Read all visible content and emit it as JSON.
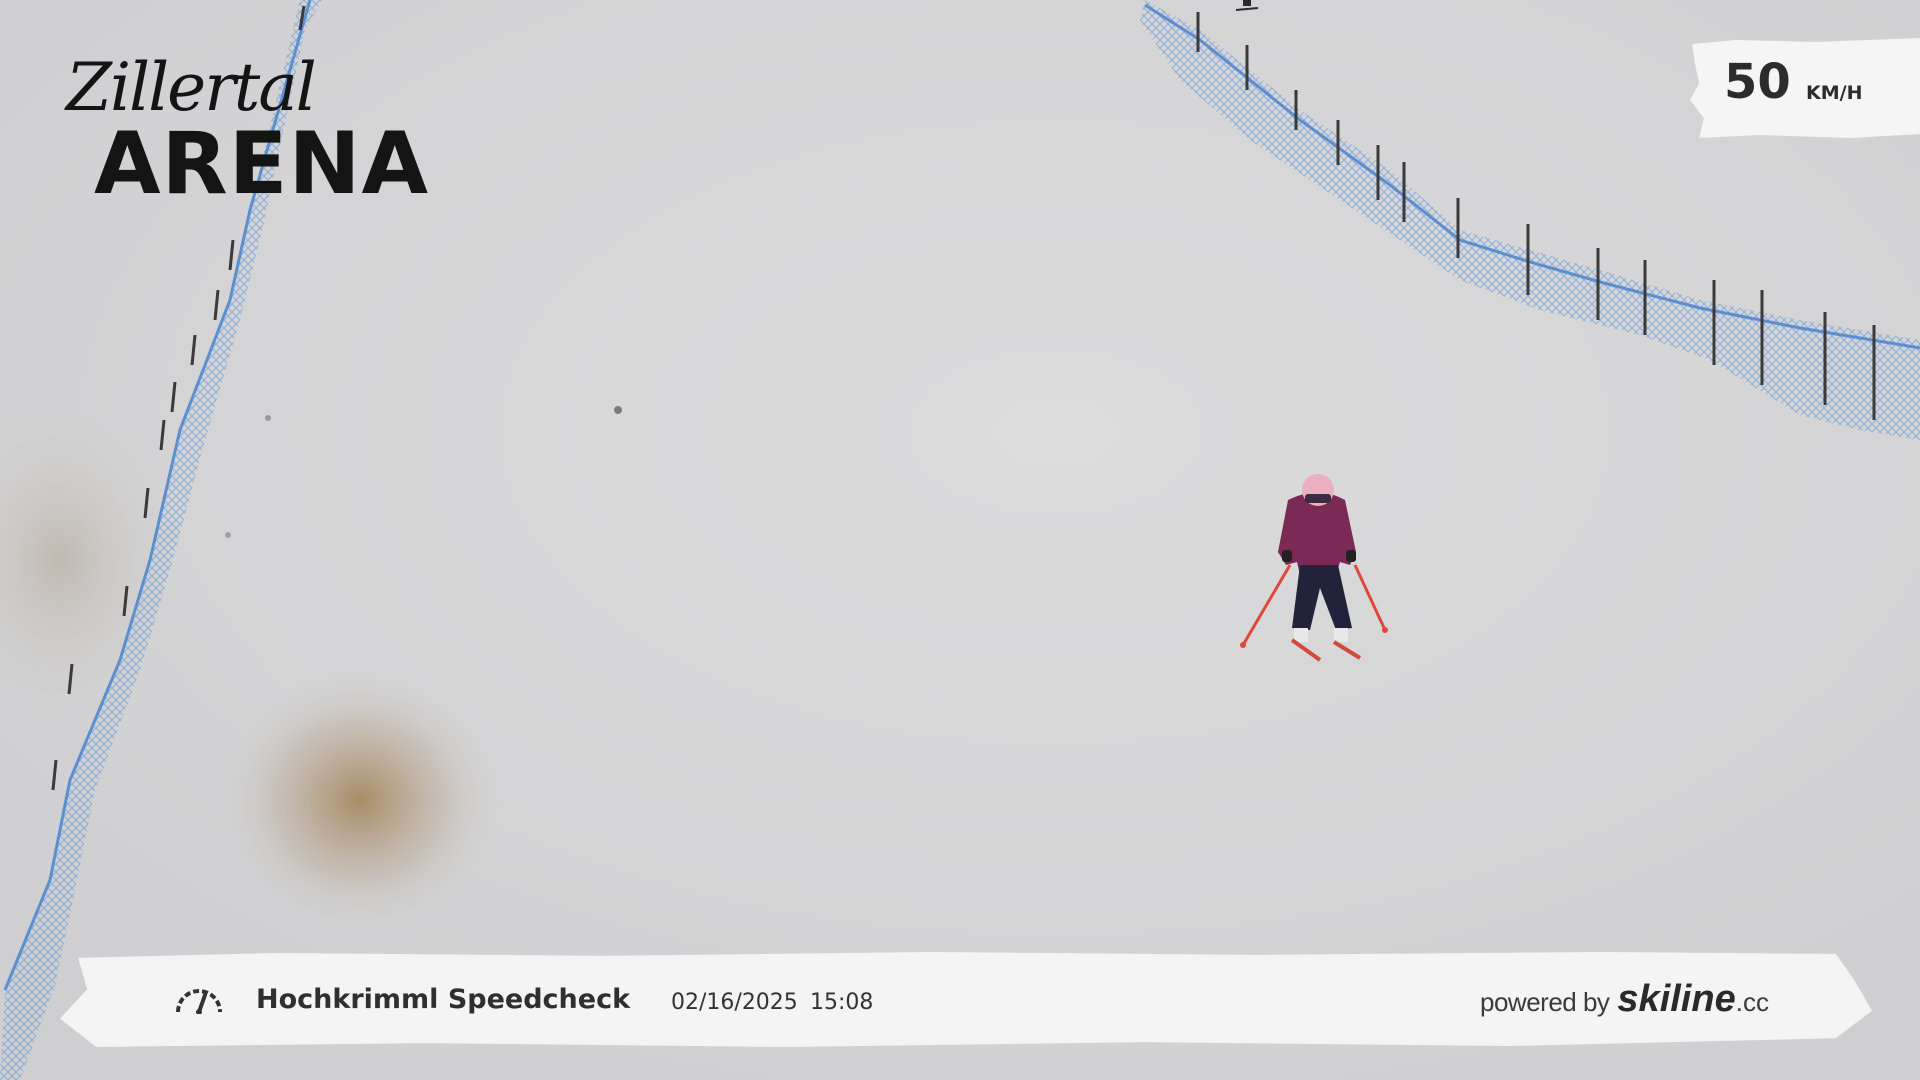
{
  "logo": {
    "script_text": "Zillertal",
    "word_text": "ARENA"
  },
  "speed": {
    "value": "50",
    "unit": "KM/H"
  },
  "banner": {
    "icon": "speedometer-icon",
    "title": "Hochkrimml Speedcheck",
    "date": "02/16/2025",
    "time": "15:08",
    "powered_label": "powered by",
    "powered_brand": "skiline",
    "powered_tld": ".cc"
  },
  "colors": {
    "snow": "#d4d4d5",
    "fence": "#6f9fd8",
    "jacket": "#7a2a55",
    "pants": "#22233a",
    "poles": "#e0463c",
    "banner_bg": "#f4f4f4"
  }
}
